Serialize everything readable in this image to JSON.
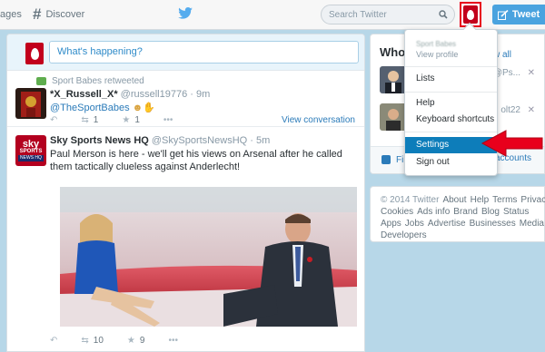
{
  "topbar": {
    "nav_pages": "ages",
    "nav_discover": "Discover",
    "search_placeholder": "Search Twitter",
    "tweet_button": "Tweet"
  },
  "composer": {
    "placeholder": "What's happening?"
  },
  "tweets": [
    {
      "retweeted_by": "Sport Babes retweeted",
      "name": "*X_Russell_X*",
      "handle": "@russell19776",
      "time": "· 9m",
      "text": "@TheSportBabes",
      "retweets": "1",
      "favorites": "1",
      "view_conversation": "View conversation"
    },
    {
      "name": "Sky Sports News HQ",
      "handle": "@SkySportsNewsHQ",
      "time": "· 5m",
      "text": "Paul Merson is here - we'll get his views on Arsenal after he called them tactically clueless against Anderlecht!",
      "retweets": "10",
      "favorites": "9",
      "avatar_text": [
        "sky",
        "SPORTS",
        "NEWS HQ"
      ]
    }
  ],
  "who_to_follow": {
    "title": "Who",
    "view_all": "w all",
    "users": [
      {
        "handle": "@Ps..."
      },
      {
        "handle": "olt22"
      }
    ],
    "find_friends": "Fi",
    "accounts": "r accounts"
  },
  "footer": {
    "links": [
      "© 2014 Twitter",
      "About",
      "Help",
      "Terms",
      "Privacy",
      "Cookies",
      "Ads info",
      "Brand",
      "Blog",
      "Status",
      "Apps",
      "Jobs",
      "Advertise",
      "Businesses",
      "Media",
      "Developers"
    ]
  },
  "dropdown": {
    "name_blurred": "Sport Babes",
    "view_profile": "View profile",
    "items": [
      "Lists",
      "Help",
      "Keyboard shortcuts",
      "Settings",
      "Sign out"
    ],
    "active": "Settings"
  },
  "colors": {
    "accent": "#4aa3df",
    "link": "#2b7bb9",
    "highlight": "#0d7dba",
    "annotation_red": "#e8001c"
  }
}
